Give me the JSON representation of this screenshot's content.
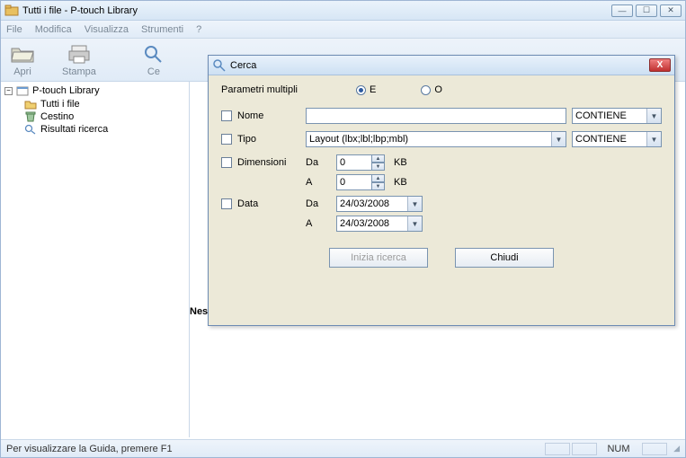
{
  "window": {
    "title": "Tutti i file - P-touch Library"
  },
  "menu": {
    "file": "File",
    "modifica": "Modifica",
    "visualizza": "Visualizza",
    "strumenti": "Strumenti",
    "help": "?"
  },
  "toolbar": {
    "apri": "Apri",
    "stampa": "Stampa",
    "cerca_partial": "Ce"
  },
  "tree": {
    "root": "P-touch Library",
    "items": [
      {
        "label": "Tutti i file"
      },
      {
        "label": "Cestino"
      },
      {
        "label": "Risultati ricerca"
      }
    ]
  },
  "content": {
    "empty_label": "Nes"
  },
  "statusbar": {
    "hint": "Per visualizzare la Guida, premere F1",
    "num": "NUM"
  },
  "dialog": {
    "title": "Cerca",
    "params_label": "Parametri multipli",
    "radio_e": "E",
    "radio_o": "O",
    "nome_label": "Nome",
    "tipo_label": "Tipo",
    "tipo_value": "Layout (lbx;lbl;lbp;mbl)",
    "dim_label": "Dimensioni",
    "data_label": "Data",
    "da_label": "Da",
    "a_label": "A",
    "dim_from": "0",
    "dim_to": "0",
    "kb": "KB",
    "date_from": "24/03/2008",
    "date_to": "24/03/2008",
    "contiene": "CONTIENE",
    "nome_value": "",
    "btn_search": "Inizia ricerca",
    "btn_close": "Chiudi"
  }
}
